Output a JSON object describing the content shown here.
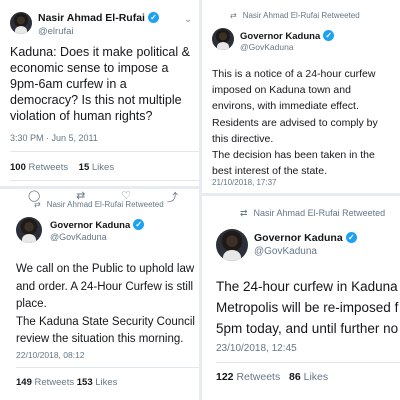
{
  "tweet1": {
    "name": "Nasir Ahmad El-Rufai",
    "handle": "@elrufai",
    "text": "Kaduna: Does it make political & economic sense to impose a 9pm-6am curfew in a democracy? Is this not multiple violation of human rights?",
    "timestamp": "3:30 PM · Jun 5, 2011",
    "retweets_count": "100",
    "retweets_label": "Retweets",
    "likes_count": "15",
    "likes_label": "Likes"
  },
  "tweet2": {
    "retweet_by": "Nasir Ahmad El-Rufai Retweeted",
    "name": "Governor Kaduna",
    "handle": "@GovKaduna",
    "text": "This is a notice of a 24-hour curfew imposed on Kaduna town and environs, with immediate effect. Residents are advised to comply by this directive.\nThe decision has been taken in the best interest of the state.",
    "timestamp": "21/10/2018, 17:37"
  },
  "tweet3": {
    "retweet_by": "Nasir Ahmad El-Rufai Retweeted",
    "name": "Governor Kaduna",
    "handle": "@GovKaduna",
    "text": "We call on the Public to uphold law and order. A 24-Hour Curfew is still place.\nThe Kaduna State Security Council review the situation this morning.",
    "timestamp": "22/10/2018, 08:12",
    "retweets_count": "149",
    "retweets_label": "Retweets",
    "likes_count": "153",
    "likes_label": "Likes"
  },
  "tweet4": {
    "retweet_by": "Nasir Ahmad El-Rufai Retweeted",
    "name": "Governor Kaduna",
    "handle": "@GovKaduna",
    "text": "The 24-hour curfew in Kaduna Metropolis will be re-imposed f 5pm today, and until further no",
    "timestamp": "23/10/2018, 12:45",
    "retweets_count": "122",
    "retweets_label": "Retweets",
    "likes_count": "86",
    "likes_label": "Likes"
  },
  "icons": {
    "verified": "verified-badge-icon",
    "retweet": "retweet-icon",
    "chevron": "chevron-down-icon",
    "reply": "reply-icon",
    "like": "heart-icon",
    "share": "share-icon"
  },
  "colors": {
    "verified_blue": "#1da1f2",
    "secondary_text": "#657786",
    "primary_text": "#14171a"
  }
}
